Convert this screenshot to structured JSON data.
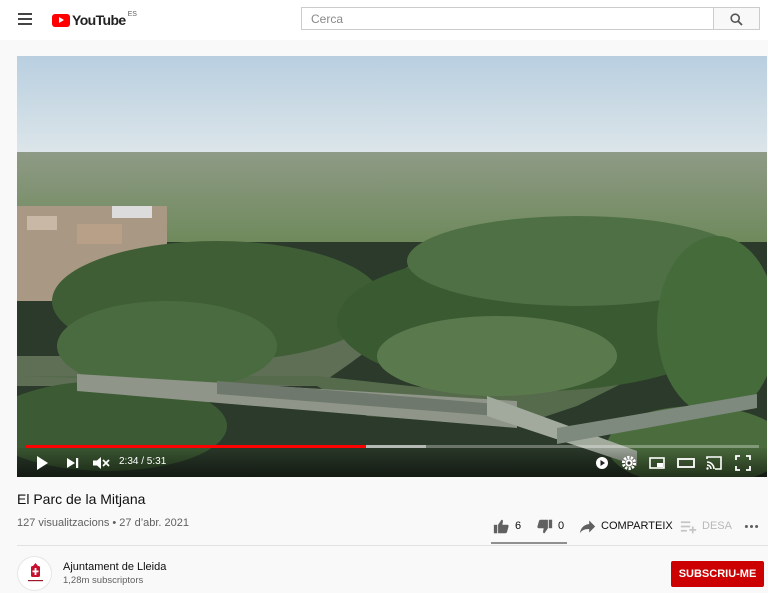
{
  "header": {
    "logo_text": "YouTube",
    "region": "ES",
    "search_placeholder": "Cerca"
  },
  "player": {
    "time": "2:34 / 5:31",
    "progress": 0.465,
    "buffered": 0.546
  },
  "video": {
    "title": "El Parc de la Mitjana",
    "meta": "127 visualitzacions • 27 d’abr. 2021"
  },
  "actions": {
    "likes": "6",
    "dislikes": "0",
    "share": "COMPARTEIX",
    "save": "DESA"
  },
  "channel": {
    "name": "Ajuntament de Lleida",
    "subscribers": "1,28m subscriptors",
    "subscribe": "SUBSCRIU-ME"
  },
  "colors": {
    "brand_red": "#ff0000",
    "subscribe_red": "#cc0000"
  }
}
